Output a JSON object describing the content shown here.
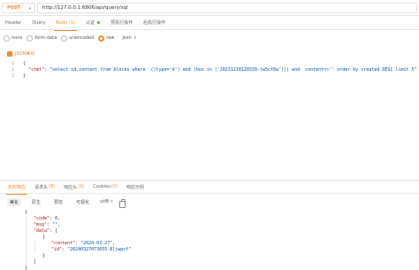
{
  "request": {
    "method": "POST",
    "url": "http://127.0.0.1:6806/api/query/sql",
    "tabs": [
      {
        "label": "Header",
        "active": false
      },
      {
        "label": "Query",
        "active": false
      },
      {
        "label": "Body",
        "count": "(1)",
        "active": true
      },
      {
        "label": "认证",
        "dot": true,
        "active": false
      },
      {
        "label": "预执行操作",
        "active": false
      },
      {
        "label": "后执行操作",
        "active": false
      }
    ],
    "body_types": [
      {
        "label": "none",
        "selected": false
      },
      {
        "label": "form-data",
        "selected": false
      },
      {
        "label": "urlencoded",
        "selected": false
      },
      {
        "label": "raw",
        "selected": true
      }
    ],
    "format": "json",
    "editor_toolbar_label": "JSON美化",
    "body_lines": [
      {
        "n": "1",
        "text": "{"
      },
      {
        "n": "2",
        "key": "\"stmt\"",
        "value": "\"select id,content from blocks where  ((type='d') and (box in ('20231218120339-tw5cf8a'))) and  content<>'' order by created DESC limit 5\""
      },
      {
        "n": "3",
        "text": "}"
      }
    ]
  },
  "response": {
    "tabs": [
      {
        "label": "实时响应",
        "active": true
      },
      {
        "label": "请求头",
        "count": "(8)",
        "active": false
      },
      {
        "label": "响应头",
        "count": "(5)",
        "active": false
      },
      {
        "label": "Cookies",
        "count": "(0)",
        "active": false
      },
      {
        "label": "响应示例",
        "active": false
      }
    ],
    "view_buttons": [
      {
        "label": "美化",
        "active": true
      },
      {
        "label": "原生",
        "active": false
      },
      {
        "label": "预览",
        "active": false
      },
      {
        "label": "可视化",
        "active": false
      }
    ],
    "encoding": "utf8",
    "body_lines": [
      {
        "indent": 0,
        "text": "{"
      },
      {
        "indent": 1,
        "key": "\"code\"",
        "sep": ": ",
        "value": "0,"
      },
      {
        "indent": 1,
        "key": "\"msg\"",
        "sep": ": ",
        "value": "\"\","
      },
      {
        "indent": 1,
        "key": "\"data\"",
        "sep": ": ",
        "value": "["
      },
      {
        "indent": 2,
        "text": "{"
      },
      {
        "indent": 3,
        "key": "\"content\"",
        "sep": ": ",
        "value": "\"2024-03-27\","
      },
      {
        "indent": 3,
        "key": "\"id\"",
        "sep": ": ",
        "value": "\"20240327073655-8ljwpcf\""
      },
      {
        "indent": 2,
        "text": "}"
      },
      {
        "indent": 1,
        "text": "]"
      },
      {
        "indent": 0,
        "text": "}"
      }
    ]
  },
  "colors": {
    "accent": "#f28c28",
    "json_key": "#a31515",
    "json_string": "#0451a5"
  }
}
